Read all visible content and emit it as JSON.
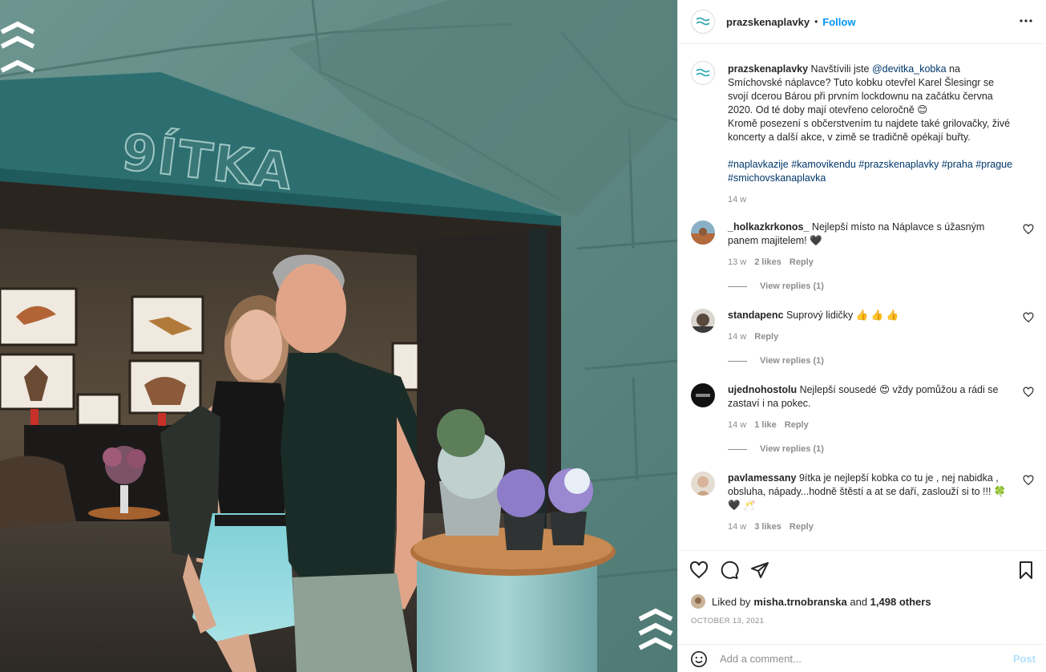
{
  "post": {
    "photo_alt": "",
    "sign_text": "9ÍTKA"
  },
  "header": {
    "username": "prazskenaplavky",
    "separator": "•",
    "follow_label": "Follow"
  },
  "caption": {
    "username": "prazskenaplavky",
    "text_1": " Navštívili jste ",
    "mention": "@devitka_kobka",
    "text_2": " na Smíchovské náplavce? Tuto kobku otevřel Karel Šlesingr se svojí dcerou Bárou při prvním lockdownu na začátku června 2020. Od té doby mají otevřeno celoročně 😊\nKromě posezení s občerstvením tu najdete také grilovačky, živé koncerty a další akce, v zimě se tradičně opékají buřty.\n\n",
    "hashtags": "#naplavkazije #kamovikendu #prazskenaplavky #praha #prague #smichovskanaplavka",
    "time": "14 w"
  },
  "comments": [
    {
      "username": "_holkazkrkonos_",
      "text": " Nejlepší místo na Náplavce s úžasným panem majitelem! 🖤",
      "time": "13 w",
      "likes": "2 likes",
      "reply": "Reply",
      "view_replies": "View replies (1)"
    },
    {
      "username": "standapenc",
      "text": " Suprový lidičky 👍 👍 👍",
      "time": "14 w",
      "likes": "",
      "reply": "Reply",
      "view_replies": "View replies (1)"
    },
    {
      "username": "ujednohostolu",
      "text": " Nejlepší sousedé 😍 vždy pomůžou a rádi se zastaví i na pokec.",
      "time": "14 w",
      "likes": "1 like",
      "reply": "Reply",
      "view_replies": "View replies (1)"
    },
    {
      "username": "pavlamessany",
      "text": " 9ítka je nejlepší kobka co tu je , nej nabidka , obsluha, nápady...hodně štěstí a at se daří, zaslouží si to !!! 🍀 🖤 🥂",
      "time": "14 w",
      "likes": "3 likes",
      "reply": "Reply",
      "view_replies": ""
    }
  ],
  "footer": {
    "liked_by_prefix": "Liked by ",
    "liked_by_user": "misha.trnobranska",
    "and": " and ",
    "others": "1,498 others",
    "date": "OCTOBER 13, 2021",
    "comment_placeholder": "Add a comment...",
    "post_label": "Post"
  },
  "icons": {
    "like": "heart-icon",
    "comment": "comment-icon",
    "share": "share-icon",
    "save": "bookmark-icon",
    "more": "more-horizontal-icon",
    "emoji": "emoji-icon"
  },
  "colors": {
    "accent": "#0095f6",
    "link": "#00376b",
    "muted": "#8e8e8e",
    "teal_wall": "#5f8a85"
  }
}
